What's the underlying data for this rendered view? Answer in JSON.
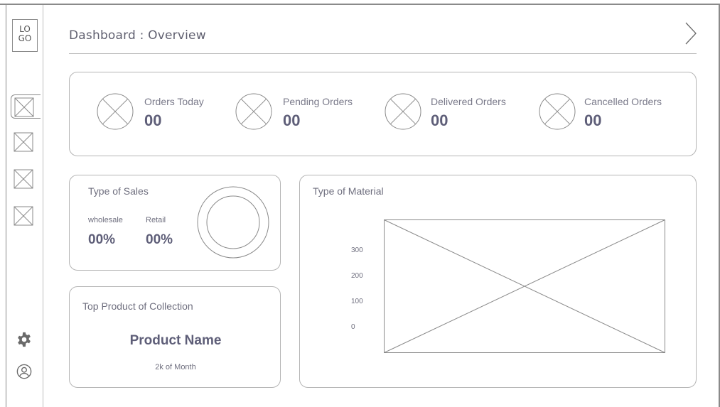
{
  "sidebar": {
    "logo_text": "LO GO",
    "logo_line1": "LO",
    "logo_line2": "GO",
    "nav_items": [
      {
        "icon": "placeholder-image-icon",
        "active": true
      },
      {
        "icon": "placeholder-image-icon",
        "active": false
      },
      {
        "icon": "placeholder-image-icon",
        "active": false
      },
      {
        "icon": "placeholder-image-icon",
        "active": false
      }
    ],
    "settings_icon": "gear-icon",
    "profile_icon": "user-icon"
  },
  "header": {
    "title": "Dashboard : Overview",
    "next_icon": "chevron-right-icon"
  },
  "stats": [
    {
      "label": "Orders Today",
      "value": "00"
    },
    {
      "label": "Pending Orders",
      "value": "00"
    },
    {
      "label": "Delivered Orders",
      "value": "00"
    },
    {
      "label": "Cancelled Orders",
      "value": "00"
    }
  ],
  "sales": {
    "title": "Type of Sales",
    "wholesale_label": "wholesale",
    "wholesale_value": "00%",
    "retail_label": "Retail",
    "retail_value": "00%"
  },
  "top_product": {
    "title": "Top Product of Collection",
    "name": "Product Name",
    "subtitle": "2k of Month"
  },
  "material": {
    "title": "Type of Material",
    "y_ticks": [
      "300",
      "200",
      "100",
      "0"
    ]
  },
  "colors": {
    "border": "#b5b5b5",
    "text": "#6e6e7e",
    "value": "#5e5e78"
  }
}
